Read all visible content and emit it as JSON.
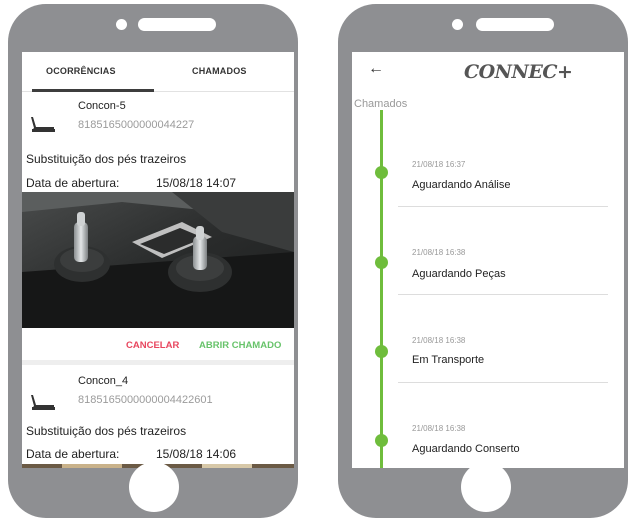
{
  "left_screen": {
    "tabs": [
      "OCORRÊNCIAS",
      "CHAMADOS"
    ],
    "cards": [
      {
        "device_name": "Concon-5",
        "serial": "8185165000000044227",
        "description": "Substituição dos pés trazeiros",
        "date_label": "Data de abertura:",
        "date_value": "15/08/18 14:07",
        "cancel_label": "CANCELAR",
        "open_label": "ABRIR CHAMADO"
      },
      {
        "device_name": "Concon_4",
        "serial": "8185165000000004422601",
        "description": "Substituição dos pés trazeiros",
        "date_label": "Data de abertura:",
        "date_value": "15/08/18 14:06"
      }
    ]
  },
  "right_screen": {
    "back_icon": "arrow-left-icon",
    "logo": "CONNEC+",
    "section_title": "Chamados",
    "timeline": [
      {
        "date": "21/08/18 16:37",
        "status": "Aguardando Análise"
      },
      {
        "date": "21/08/18 16:38",
        "status": "Aguardando Peças"
      },
      {
        "date": "21/08/18 16:38",
        "status": "Em Transporte"
      },
      {
        "date": "21/08/18 16:38",
        "status": "Aguardando Conserto"
      }
    ]
  },
  "colors": {
    "phone_body": "#8e8f92",
    "cancel": "#e8465e",
    "open_call": "#67c36a",
    "timeline": "#6fbd3c"
  }
}
